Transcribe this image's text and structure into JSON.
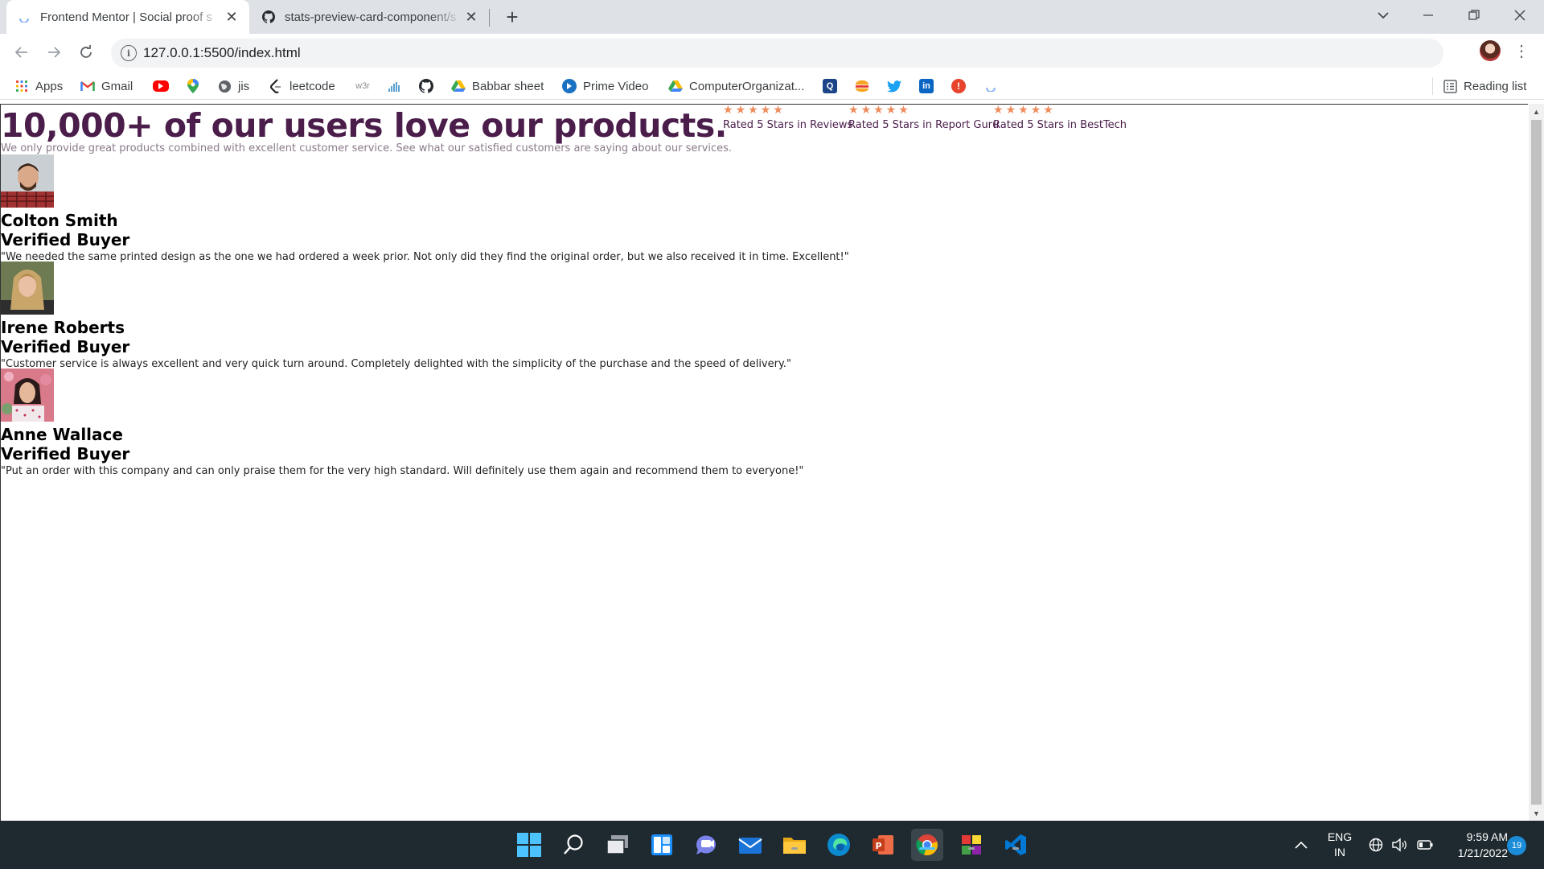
{
  "browser": {
    "tabs": [
      {
        "title": "Frontend Mentor | Social proof s",
        "active": true
      },
      {
        "title": "stats-preview-card-component/s",
        "active": false
      }
    ],
    "url": "127.0.0.1:5500/index.html",
    "bookmarks": [
      {
        "label": "Apps",
        "icon": "apps-grid-icon"
      },
      {
        "label": "Gmail",
        "icon": "gmail-icon"
      },
      {
        "label": "",
        "icon": "youtube-icon"
      },
      {
        "label": "",
        "icon": "maps-icon"
      },
      {
        "label": "jis",
        "icon": "globe-icon"
      },
      {
        "label": "leetcode",
        "icon": "leetcode-icon"
      },
      {
        "label": "",
        "icon": "w3schools-icon"
      },
      {
        "label": "",
        "icon": "chart-icon"
      },
      {
        "label": "",
        "icon": "github-icon"
      },
      {
        "label": "Babbar sheet",
        "icon": "drive-icon"
      },
      {
        "label": "Prime Video",
        "icon": "prime-video-icon"
      },
      {
        "label": "ComputerOrganizat...",
        "icon": "drive-icon"
      },
      {
        "label": "",
        "icon": "search-q-icon"
      },
      {
        "label": "",
        "icon": "burger-icon"
      },
      {
        "label": "",
        "icon": "twitter-icon"
      },
      {
        "label": "",
        "icon": "linkedin-icon"
      },
      {
        "label": "",
        "icon": "alert-icon"
      },
      {
        "label": "",
        "icon": "loading-icon"
      }
    ],
    "reading_list": "Reading list"
  },
  "page": {
    "headline": "10,000+ of our users love our products.",
    "subline": "We only provide great products combined with excellent customer service. See what our satisfied customers are saying about our services.",
    "ratings": [
      {
        "label": "Rated 5 Stars in Reviews",
        "stars": 5
      },
      {
        "label": "Rated 5 Stars in Report Guru",
        "stars": 5
      },
      {
        "label": "Rated 5 Stars in BestTech",
        "stars": 5
      }
    ],
    "testimonials": [
      {
        "name": "Colton Smith",
        "role": "Verified Buyer",
        "quote": "\"We needed the same printed design as the one we had ordered a week prior. Not only did they find the original order, but we also received it in time. Excellent!\""
      },
      {
        "name": "Irene Roberts",
        "role": "Verified Buyer",
        "quote": "\"Customer service is always excellent and very quick turn around. Completely delighted with the simplicity of the purchase and the speed of delivery.\""
      },
      {
        "name": "Anne Wallace",
        "role": "Verified Buyer",
        "quote": "\"Put an order with this company and can only praise them for the very high standard. Will definitely use them again and recommend them to everyone!\""
      }
    ]
  },
  "taskbar": {
    "language": {
      "line1": "ENG",
      "line2": "IN"
    },
    "time": "9:59 AM",
    "date": "1/21/2022",
    "notifications": "19"
  },
  "colors": {
    "headline": "#4a1d4a",
    "star": "#ee8b5c",
    "taskbar": "#1f2a30"
  }
}
